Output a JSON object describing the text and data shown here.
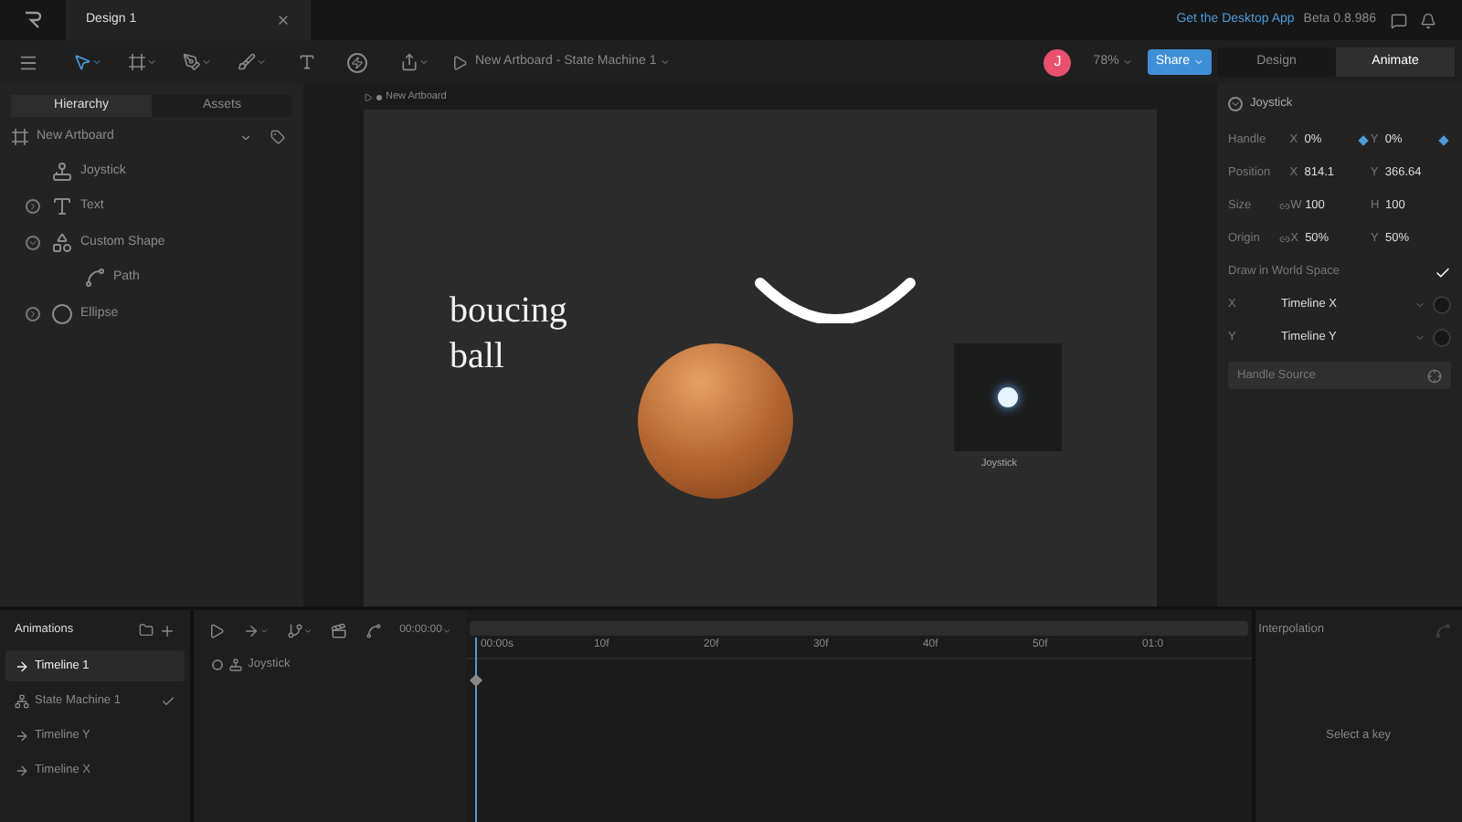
{
  "app_tab": {
    "title": "Design 1"
  },
  "header": {
    "desktop_link": "Get the Desktop App",
    "version": "Beta 0.8.986"
  },
  "toolbar": {
    "breadcrumb": "New Artboard - State Machine 1",
    "avatar": "J",
    "zoom": "78%",
    "share": "Share",
    "modes": [
      {
        "label": "Design",
        "selected": false
      },
      {
        "label": "Animate",
        "selected": true
      }
    ]
  },
  "left_panel": {
    "tabs": [
      {
        "label": "Hierarchy",
        "selected": true
      },
      {
        "label": "Assets",
        "selected": false
      }
    ],
    "artboard": "New Artboard",
    "layers": [
      {
        "name": "Joystick",
        "kind": "joystick"
      },
      {
        "name": "Text",
        "kind": "text",
        "expanded": false
      },
      {
        "name": "Custom Shape",
        "kind": "shape",
        "expanded": true,
        "children": [
          {
            "name": "Path",
            "kind": "path"
          }
        ]
      },
      {
        "name": "Ellipse",
        "kind": "ellipse",
        "expanded": false
      }
    ]
  },
  "canvas": {
    "artboard_label": "New Artboard",
    "text": "boucing ball",
    "joystick_label": "Joystick"
  },
  "right_panel": {
    "object": "Joystick",
    "rows": [
      {
        "label": "Handle",
        "linked": false,
        "fields": [
          {
            "axis": "X",
            "value": "0%",
            "keyed": true
          },
          {
            "axis": "Y",
            "value": "0%",
            "keyed": true
          }
        ]
      },
      {
        "label": "Position",
        "linked": false,
        "fields": [
          {
            "axis": "X",
            "value": "814.1",
            "keyed": false
          },
          {
            "axis": "Y",
            "value": "366.64",
            "keyed": false
          }
        ]
      },
      {
        "label": "Size",
        "linked": true,
        "fields": [
          {
            "axis": "W",
            "value": "100",
            "keyed": false
          },
          {
            "axis": "H",
            "value": "100",
            "keyed": false
          }
        ]
      },
      {
        "label": "Origin",
        "linked": true,
        "fields": [
          {
            "axis": "X",
            "value": "50%",
            "keyed": false
          },
          {
            "axis": "Y",
            "value": "50%",
            "keyed": false
          }
        ]
      }
    ],
    "world_space": {
      "label": "Draw in World Space",
      "checked": true
    },
    "bindings": [
      {
        "axis": "X",
        "value": "Timeline X"
      },
      {
        "axis": "Y",
        "value": "Timeline Y"
      }
    ],
    "handle_source": "Handle Source"
  },
  "animations": {
    "title": "Animations",
    "items": [
      {
        "name": "Timeline 1",
        "kind": "timeline",
        "selected": true,
        "checked": false
      },
      {
        "name": "State Machine 1",
        "kind": "state_machine",
        "selected": false,
        "checked": true
      },
      {
        "name": "Timeline Y",
        "kind": "timeline",
        "selected": false,
        "checked": false
      },
      {
        "name": "Timeline X",
        "kind": "timeline",
        "selected": false,
        "checked": false
      }
    ]
  },
  "timeline": {
    "time": "00:00:00",
    "ticks": [
      "00:00s",
      "10f",
      "20f",
      "30f",
      "40f",
      "50f",
      "01:0"
    ],
    "tracks": [
      {
        "name": "Joystick"
      }
    ]
  },
  "interpolation": {
    "title": "Interpolation",
    "empty": "Select a key"
  }
}
